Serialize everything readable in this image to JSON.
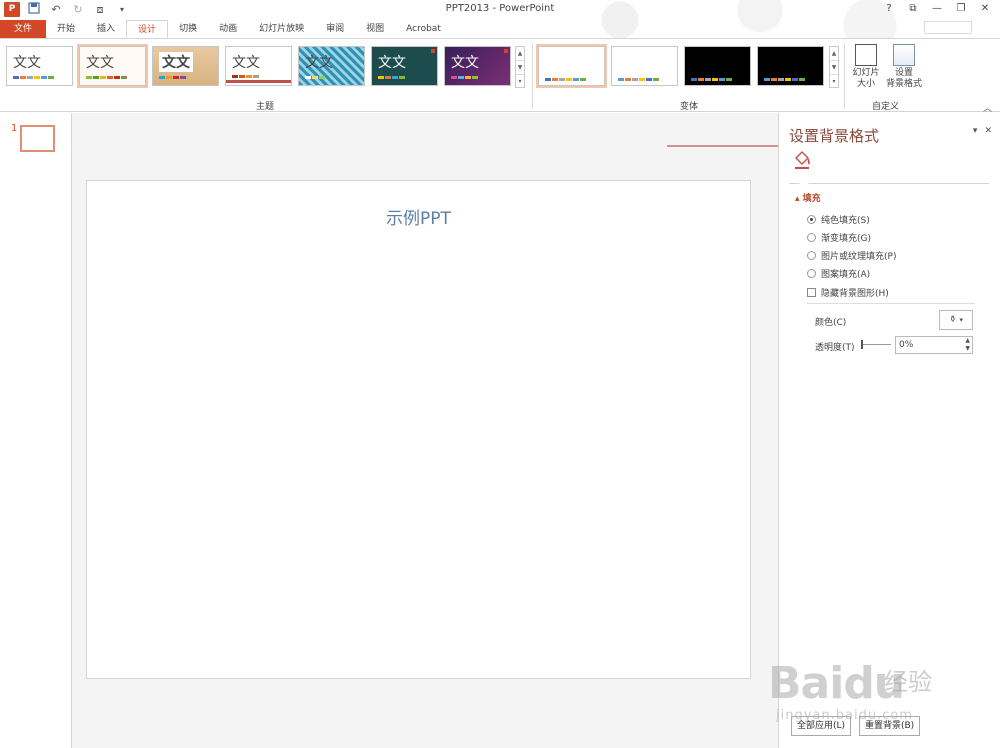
{
  "app": {
    "title": "PPT2013 - PowerPoint",
    "logo": "P"
  },
  "window_controls": [
    "?",
    "⧉",
    "—",
    "❐",
    "✕"
  ],
  "tabs": [
    {
      "label": "文件",
      "kind": "file"
    },
    {
      "label": "开始"
    },
    {
      "label": "插入"
    },
    {
      "label": "设计",
      "active": true
    },
    {
      "label": "切换"
    },
    {
      "label": "动画"
    },
    {
      "label": "幻灯片放映"
    },
    {
      "label": "审阅"
    },
    {
      "label": "视图"
    },
    {
      "label": "Acrobat"
    }
  ],
  "ribbon": {
    "themes_label": "主题",
    "variants_label": "变体",
    "customize_label": "自定义",
    "theme_text": "文文",
    "slide_size_label_1": "幻灯片",
    "slide_size_label_2": "大小",
    "format_bg_label_1": "设置",
    "format_bg_label_2": "背景格式"
  },
  "thumbnails": {
    "first_number": "1"
  },
  "slide": {
    "title": "示例PPT"
  },
  "format_pane": {
    "title": "设置背景格式",
    "section": "填充",
    "options": [
      {
        "label": "纯色填充(S)",
        "selected": true
      },
      {
        "label": "渐变填充(G)",
        "selected": false
      },
      {
        "label": "图片或纹理填充(P)",
        "selected": false
      },
      {
        "label": "图案填充(A)",
        "selected": false
      }
    ],
    "hide_bg_graphics": "隐藏背景图形(H)",
    "color_label": "颜色(C)",
    "transparency_label": "透明度(T)",
    "transparency_value": "0%",
    "apply_all": "全部应用(L)",
    "reset_bg": "重置背景(B)"
  },
  "watermark": {
    "brand": "Bai",
    "brand2": "du",
    "cn": "经验",
    "url": "jingyan.baidu.com"
  },
  "colors": {
    "accent": "#d24726",
    "pane_title": "#8a4a3a",
    "slide_title": "#5b7fa4"
  }
}
